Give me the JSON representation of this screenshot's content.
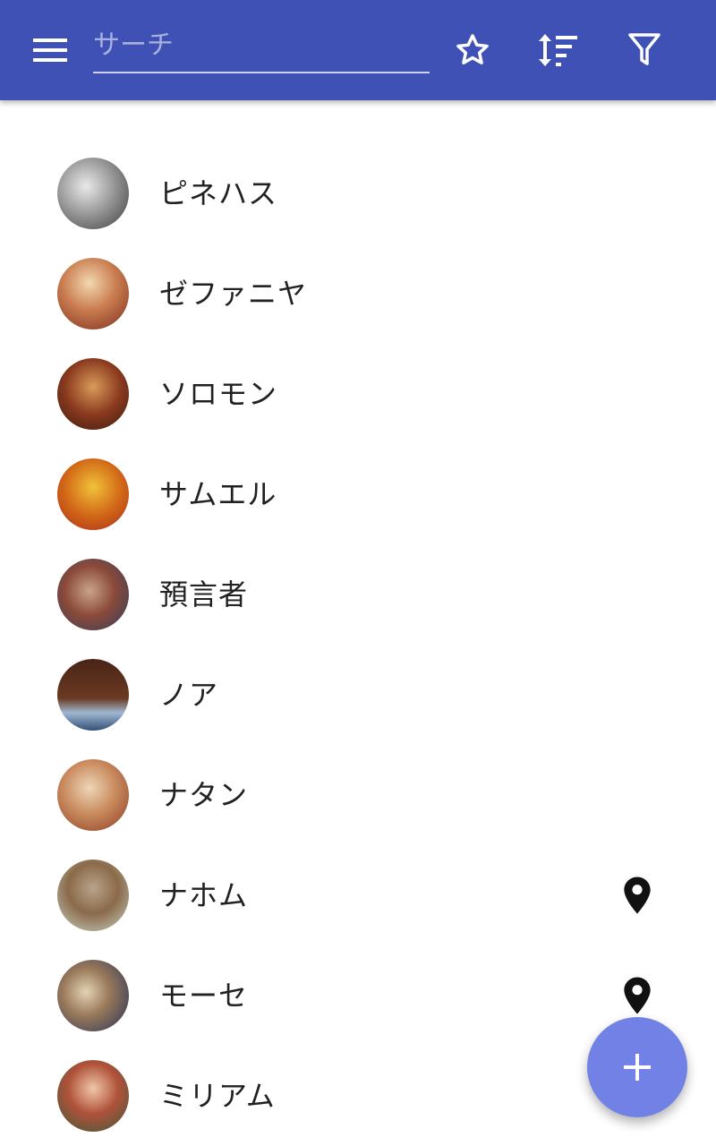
{
  "appbar": {
    "search_placeholder": "サーチ",
    "icons": {
      "menu": "menu-icon",
      "favorites": "star-outline-icon",
      "sort": "sort-icon",
      "filter": "filter-icon"
    }
  },
  "colors": {
    "appbar": "#3f51b5",
    "fab": "#7281e6",
    "text": "#212121"
  },
  "list": {
    "items": [
      {
        "name": "ピネハス",
        "has_location": false
      },
      {
        "name": "ゼファニヤ",
        "has_location": false
      },
      {
        "name": "ソロモン",
        "has_location": false
      },
      {
        "name": "サムエル",
        "has_location": false
      },
      {
        "name": "預言者",
        "has_location": false
      },
      {
        "name": "ノア",
        "has_location": false
      },
      {
        "name": "ナタン",
        "has_location": false
      },
      {
        "name": "ナホム",
        "has_location": true
      },
      {
        "name": "モーセ",
        "has_location": true
      },
      {
        "name": "ミリアム",
        "has_location": false
      }
    ]
  },
  "fab": {
    "icon": "plus-icon"
  }
}
